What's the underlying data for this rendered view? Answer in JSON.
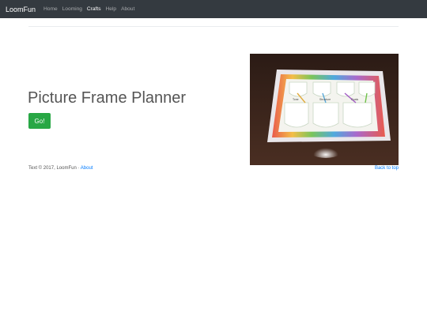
{
  "navbar": {
    "brand": "LoomFun",
    "links": [
      {
        "label": "Home",
        "active": false
      },
      {
        "label": "Looming",
        "active": false
      },
      {
        "label": "Crafts",
        "active": true
      },
      {
        "label": "Help",
        "active": false
      },
      {
        "label": "About",
        "active": false
      }
    ]
  },
  "hero": {
    "title": "Picture Frame Planner",
    "button_label": "Go!"
  },
  "image": {
    "labels": [
      "Tone",
      "Structure",
      "Goals"
    ]
  },
  "footer": {
    "text": "Text © 2017, LoomFun ·",
    "about_link": "About",
    "back_to_top": "Back to top"
  },
  "colors": {
    "navbar_bg": "#343a40",
    "button_green": "#28a745",
    "link_blue": "#007bff"
  }
}
